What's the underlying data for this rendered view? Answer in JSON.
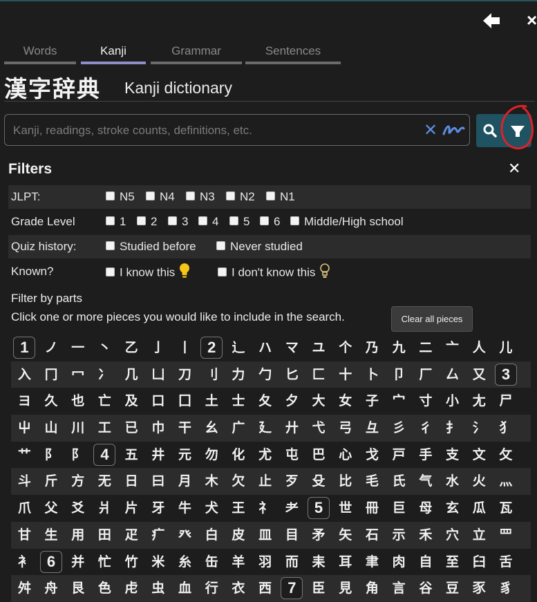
{
  "tabs": [
    {
      "label": "Words",
      "active": false
    },
    {
      "label": "Kanji",
      "active": true
    },
    {
      "label": "Grammar",
      "active": false
    },
    {
      "label": "Sentences",
      "active": false
    }
  ],
  "header": {
    "title_kanji": "漢字辞典",
    "title_en": "Kanji dictionary"
  },
  "search": {
    "placeholder": "Kanji, readings, stroke counts, definitions, etc.",
    "value": ""
  },
  "filters": {
    "title": "Filters",
    "jlpt": {
      "label": "JLPT:",
      "options": [
        "N5",
        "N4",
        "N3",
        "N2",
        "N1"
      ]
    },
    "grade": {
      "label": "Grade Level",
      "options": [
        "1",
        "2",
        "3",
        "4",
        "5",
        "6",
        "Middle/High school"
      ]
    },
    "quiz": {
      "label": "Quiz history:",
      "options": [
        "Studied before",
        "Never studied"
      ]
    },
    "known": {
      "label": "Known?",
      "options": [
        "I know this",
        "I don't know this"
      ]
    }
  },
  "parts": {
    "heading": "Filter by parts",
    "instruction": "Click one or more pieces you would like to include in the search.",
    "clear_label": "Clear all pieces",
    "rows": [
      [
        "1",
        "ノ",
        "一",
        "丶",
        "乙",
        "亅",
        "丨",
        "2",
        "辶",
        "ハ",
        "マ",
        "ユ",
        "个",
        "乃",
        "九",
        "二",
        "亠",
        "人",
        "儿"
      ],
      [
        "入",
        "冂",
        "冖",
        "冫",
        "几",
        "凵",
        "刀",
        "刂",
        "力",
        "勹",
        "匕",
        "匚",
        "十",
        "卜",
        "卩",
        "厂",
        "厶",
        "又",
        "3"
      ],
      [
        "ヨ",
        "久",
        "也",
        "亡",
        "及",
        "口",
        "囗",
        "土",
        "士",
        "夂",
        "夕",
        "大",
        "女",
        "子",
        "宀",
        "寸",
        "小",
        "尢",
        "尸"
      ],
      [
        "屮",
        "山",
        "川",
        "工",
        "已",
        "巾",
        "干",
        "幺",
        "广",
        "廴",
        "廾",
        "弋",
        "弓",
        "彑",
        "彡",
        "彳",
        "扌",
        "氵",
        "犭"
      ],
      [
        "艹",
        "阝",
        "阝",
        "4",
        "五",
        "井",
        "元",
        "勿",
        "化",
        "尤",
        "屯",
        "巴",
        "心",
        "戈",
        "戸",
        "手",
        "支",
        "文",
        "攵"
      ],
      [
        "斗",
        "斤",
        "方",
        "无",
        "日",
        "曰",
        "月",
        "木",
        "欠",
        "止",
        "歹",
        "殳",
        "比",
        "毛",
        "氏",
        "气",
        "水",
        "火",
        "灬"
      ],
      [
        "爪",
        "父",
        "爻",
        "爿",
        "片",
        "牙",
        "牛",
        "犬",
        "王",
        "礻",
        "耂",
        "5",
        "世",
        "冊",
        "巨",
        "母",
        "玄",
        "瓜",
        "瓦"
      ],
      [
        "甘",
        "生",
        "用",
        "田",
        "疋",
        "疒",
        "癶",
        "白",
        "皮",
        "皿",
        "目",
        "矛",
        "矢",
        "石",
        "示",
        "禾",
        "穴",
        "立",
        "罒"
      ],
      [
        "衤",
        "6",
        "并",
        "忙",
        "竹",
        "米",
        "糸",
        "缶",
        "羊",
        "羽",
        "而",
        "耒",
        "耳",
        "聿",
        "肉",
        "自",
        "至",
        "臼",
        "舌"
      ],
      [
        "舛",
        "舟",
        "艮",
        "色",
        "虍",
        "虫",
        "血",
        "行",
        "衣",
        "西",
        "7",
        "臣",
        "見",
        "角",
        "言",
        "谷",
        "豆",
        "豕",
        "豸"
      ]
    ]
  },
  "colors": {
    "accent": "#8f8cc9",
    "button_bg": "#1f5361",
    "annotation": "#e0202a",
    "bulb_on": "#f5c518"
  }
}
